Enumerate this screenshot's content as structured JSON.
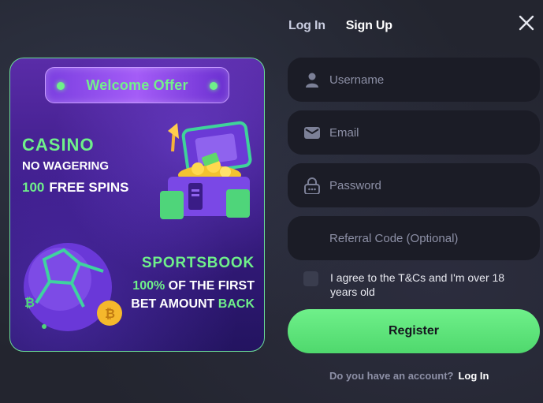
{
  "tabs": {
    "login": "Log In",
    "signup": "Sign Up"
  },
  "promo": {
    "welcome": "Welcome Offer",
    "casino_title": "CASINO",
    "casino_line1": "NO WAGERING",
    "casino_num": "100",
    "casino_line2": "FREE SPINS",
    "sports_title": "SPORTSBOOK",
    "sports_pct": "100%",
    "sports_line1_rest": " OF THE FIRST",
    "sports_line2_a": "BET AMOUNT ",
    "sports_line2_b": "BACK"
  },
  "form": {
    "username_placeholder": "Username",
    "email_placeholder": "Email",
    "password_placeholder": "Password",
    "referral_placeholder": "Referral Code (Optional)",
    "agree_text": "I agree to the T&Cs and I'm over 18 years old",
    "register_label": "Register",
    "have_account": "Do you have an account?",
    "login_link": "Log In"
  },
  "icons": {
    "close": "close-icon",
    "user": "user-icon",
    "email": "mail-icon",
    "password": "lock-icon"
  },
  "colors": {
    "accent_green": "#6ff08a",
    "field_bg": "#1b1c26",
    "promo_purple": "#3b1c86"
  }
}
